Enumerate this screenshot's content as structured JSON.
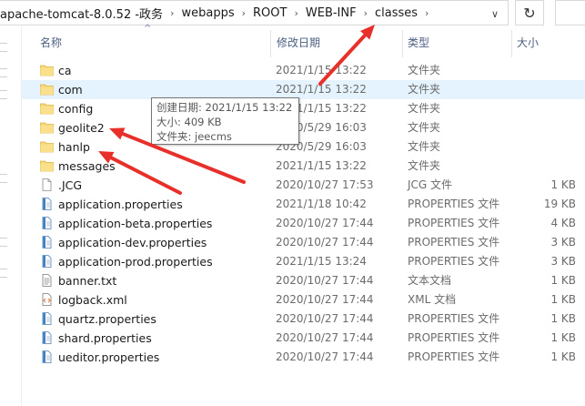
{
  "address": {
    "crumbs": [
      "apache-tomcat-8.0.52 -政务",
      "webapps",
      "ROOT",
      "WEB-INF",
      "classes"
    ],
    "separator": "›",
    "dropdown_glyph": "∨",
    "refresh_glyph": "↻"
  },
  "columns": {
    "name": "名称",
    "date": "修改日期",
    "type": "类型",
    "size": "大小",
    "sort_glyph": "^"
  },
  "files": [
    {
      "name": "ca",
      "date": "2021/1/15 13:22",
      "type": "文件夹",
      "size": "",
      "icon": "folder-icon"
    },
    {
      "name": "com",
      "date": "2021/1/15 13:22",
      "type": "文件夹",
      "size": "",
      "icon": "folder-icon"
    },
    {
      "name": "config",
      "date": "2021/1/15 13:22",
      "type": "文件夹",
      "size": "",
      "icon": "folder-icon"
    },
    {
      "name": "geolite2",
      "date": "2020/5/29 16:03",
      "type": "文件夹",
      "size": "",
      "icon": "folder-icon"
    },
    {
      "name": "hanlp",
      "date": "2020/5/29 16:03",
      "type": "文件夹",
      "size": "",
      "icon": "folder-icon"
    },
    {
      "name": "messages",
      "date": "2021/1/15 13:22",
      "type": "文件夹",
      "size": "",
      "icon": "folder-icon"
    },
    {
      "name": ".JCG",
      "date": "2020/10/27 17:53",
      "type": "JCG 文件",
      "size": "1 KB",
      "icon": "file-icon"
    },
    {
      "name": "application.properties",
      "date": "2021/1/18 10:42",
      "type": "PROPERTIES 文件",
      "size": "19 KB",
      "icon": "properties-icon"
    },
    {
      "name": "application-beta.properties",
      "date": "2020/10/27 17:44",
      "type": "PROPERTIES 文件",
      "size": "4 KB",
      "icon": "properties-icon"
    },
    {
      "name": "application-dev.properties",
      "date": "2020/10/27 17:44",
      "type": "PROPERTIES 文件",
      "size": "3 KB",
      "icon": "properties-icon"
    },
    {
      "name": "application-prod.properties",
      "date": "2021/1/15 13:24",
      "type": "PROPERTIES 文件",
      "size": "3 KB",
      "icon": "properties-icon"
    },
    {
      "name": "banner.txt",
      "date": "2020/10/27 17:44",
      "type": "文本文档",
      "size": "1 KB",
      "icon": "text-file-icon"
    },
    {
      "name": "logback.xml",
      "date": "2020/10/27 17:44",
      "type": "XML 文档",
      "size": "1 KB",
      "icon": "xml-file-icon"
    },
    {
      "name": "quartz.properties",
      "date": "2020/10/27 17:44",
      "type": "PROPERTIES 文件",
      "size": "1 KB",
      "icon": "properties-icon"
    },
    {
      "name": "shard.properties",
      "date": "2020/10/27 17:44",
      "type": "PROPERTIES 文件",
      "size": "1 KB",
      "icon": "properties-icon"
    },
    {
      "name": "ueditor.properties",
      "date": "2020/10/27 17:44",
      "type": "PROPERTIES 文件",
      "size": "1 KB",
      "icon": "properties-icon"
    }
  ],
  "tooltip": {
    "line1": "创建日期: 2021/1/15 13:22",
    "line2": "大小: 409 KB",
    "line3": "文件夹: jeecms"
  },
  "colors": {
    "annotation_arrow": "#e8302a",
    "folder": "#f8d775",
    "hover_row": "#e5f3ff",
    "header_text": "#4d6082"
  }
}
